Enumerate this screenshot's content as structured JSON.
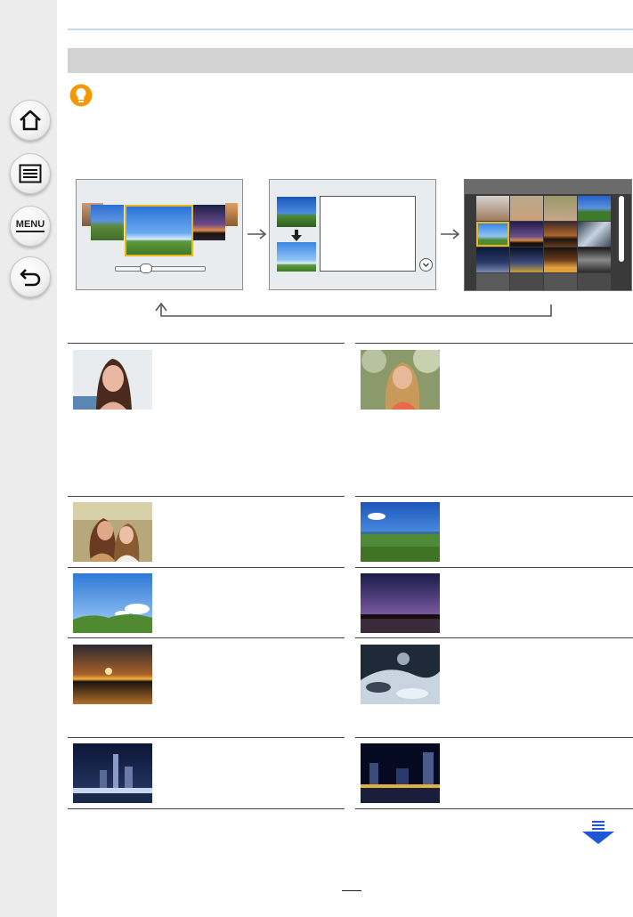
{
  "sidebar": {
    "buttons": [
      {
        "name": "home-button",
        "icon": "home-icon"
      },
      {
        "name": "contents-button",
        "icon": "list-icon"
      },
      {
        "name": "menu-button",
        "label": "MENU"
      },
      {
        "name": "back-button",
        "icon": "back-arrow-icon"
      }
    ]
  },
  "colors": {
    "sidebar_bg": "#ececec",
    "section_bar": "#d2d2d2",
    "tip_icon": "#f39800",
    "highlight_frame": "#e8b81c",
    "next_arrow": "#1d57d6"
  },
  "icons": {
    "tip": "lightbulb-icon",
    "next_page": "down-arrow-icon"
  }
}
